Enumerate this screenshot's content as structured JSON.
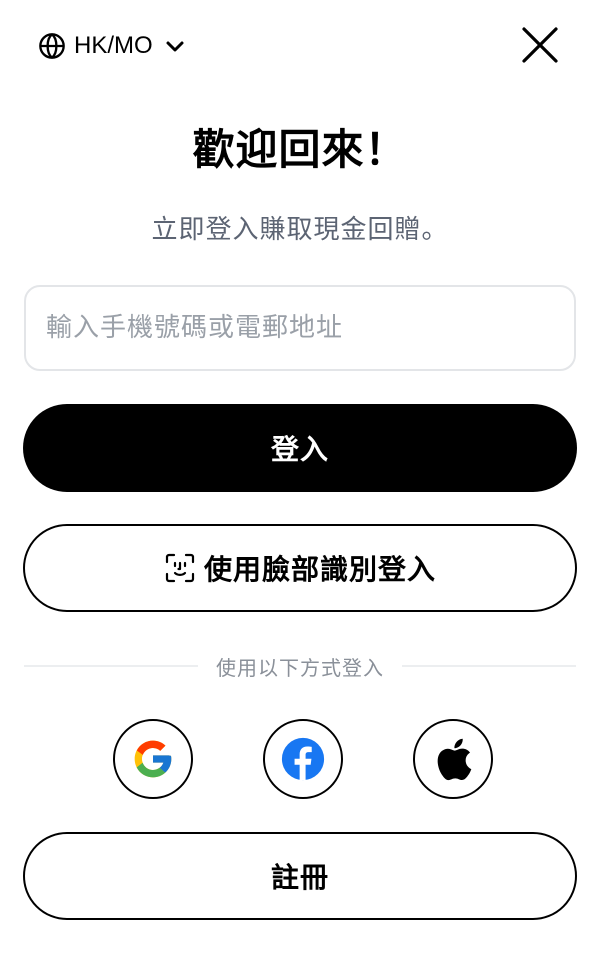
{
  "header": {
    "region_label": "HK/MO",
    "region_icon": "globe-icon",
    "dropdown_icon": "chevron-down-icon",
    "close_icon": "close-icon"
  },
  "login": {
    "title": "歡迎回來！",
    "subtitle": "立即登入賺取現金回贈。",
    "input_placeholder": "輸入手機號碼或電郵地址",
    "input_value": "",
    "login_button_label": "登入",
    "face_login_label": "使用臉部識別登入",
    "face_login_icon": "face-id-icon",
    "divider_text": "使用以下方式登入",
    "social": [
      {
        "name": "Google",
        "icon": "google-icon"
      },
      {
        "name": "Facebook",
        "icon": "facebook-icon"
      },
      {
        "name": "Apple",
        "icon": "apple-icon"
      }
    ],
    "register_button_label": "註冊"
  },
  "colors": {
    "primary": "#000000",
    "background": "#ffffff",
    "subtitle_text": "#5c6473",
    "placeholder_text": "#9aa0a8",
    "input_border": "#e3e5e8",
    "divider": "#eceef0",
    "google_blue": "#4285F4",
    "google_red": "#EA4335",
    "google_yellow": "#FBBC05",
    "google_green": "#34A853",
    "facebook_blue": "#1877F2"
  }
}
